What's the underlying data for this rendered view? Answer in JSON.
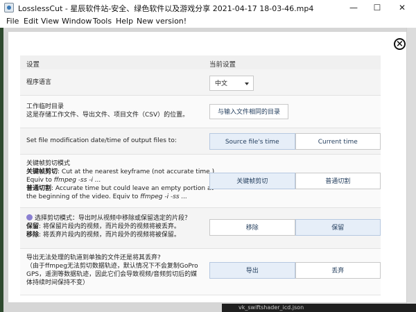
{
  "window": {
    "title": "LosslessCut - 星辰软件站-安全、绿色软件以及游戏分享 2021-04-17 18-03-46.mp4",
    "controls": {
      "minimize": "—",
      "maximize": "☐",
      "close": "✕"
    }
  },
  "menu": [
    "File",
    "Edit",
    "View",
    "Window",
    "Tools",
    "Help",
    "New version!"
  ],
  "settings": {
    "header": {
      "setting": "设置",
      "current": "当前设置"
    },
    "language": {
      "label": "程序语言",
      "value": "中文"
    },
    "workdir": {
      "label": "工作临时目录",
      "desc": "这是存储工作文件、导出文件、项目文件（CSV）的位置。",
      "button": "与输入文件相同的目录"
    },
    "modtime": {
      "label": "Set file modification date/time of output files to:",
      "options": [
        "Source file's time",
        "Current time"
      ]
    },
    "keyframe": {
      "title": "关键帧剪切模式",
      "l1a": "关键帧剪切",
      "l1b": ": Cut at the nearest keyframe (not accurate time.)",
      "l2a": "Equiv to ",
      "l2b": "ffmpeg -ss -i ...",
      "l3a": "普通切割",
      "l3b": ": Accurate time but could leave an empty portion at",
      "l4a": "the beginning of the video. Equiv to ",
      "l4b": "ffmpeg -i -ss ...",
      "options": [
        "关键帧剪切",
        "普通切割"
      ]
    },
    "cutmode": {
      "title": "选择剪切模式：导出时从视频中移除或保留选定的片段？",
      "l2a": "保留",
      "l2b": ": 将保留片段内的视频，而片段外的视频将被丢弃。",
      "l3a": "移除",
      "l3b": ": 将丢弃片段内的视频，而片段外的视频将被保留。",
      "options": [
        "移除",
        "保留"
      ]
    },
    "tracks": {
      "title": "导出无法处理的轨道到单独的文件还是将其丢弃?",
      "l2": "（由于ffmpeg无法剪切数据轨迹，默认情况下不会复制GoPro",
      "l3": "GPS，遥测等数据轨迹，因此它们会导致视频/音频剪切后的媒",
      "l4": "体持续时间保持不变）",
      "options": [
        "导出",
        "丢弃"
      ]
    }
  },
  "background_peek": "vk_swiftshader_icd.json"
}
